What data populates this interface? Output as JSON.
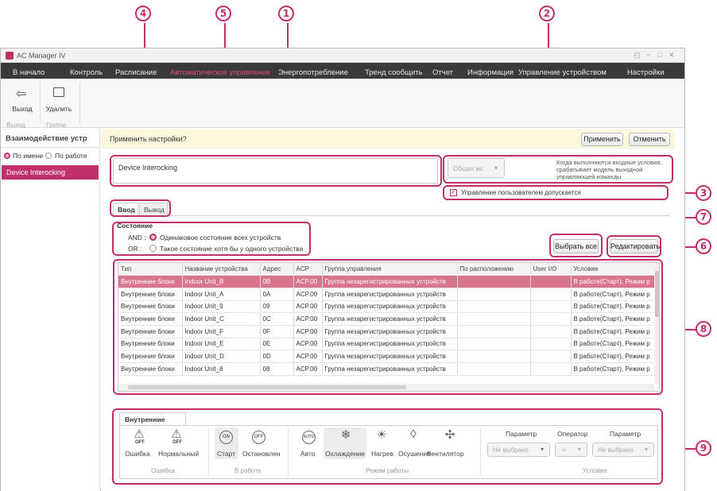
{
  "window": {
    "title": "AC Manager IV",
    "controls": [
      "◰",
      "−",
      "□",
      "✕"
    ]
  },
  "menu": [
    {
      "label": "В начало",
      "active": false
    },
    {
      "label": "Контроль",
      "active": false
    },
    {
      "label": "Расписание",
      "active": false
    },
    {
      "label": "Автоматическое управление",
      "active": true
    },
    {
      "label": "Энергопотребление",
      "active": false
    },
    {
      "label": "Тренд сообщить",
      "active": false
    },
    {
      "label": "Отчет",
      "active": false
    },
    {
      "label": "Информация",
      "active": false
    },
    {
      "label": "Управление устройством",
      "active": false
    },
    {
      "label": "Настройки",
      "active": false
    }
  ],
  "ribbon": {
    "exit_label": "Выход",
    "delete_label": "Удалить",
    "group_exit": "Выход",
    "group_group": "Группа"
  },
  "sidebar": {
    "title": "Взаимодействие устр",
    "radio_name": "По имени",
    "radio_work": "По работе",
    "item": "Device Interocking"
  },
  "topbar": {
    "question": "Применить настройки?",
    "apply": "Применить",
    "cancel": "Отменить"
  },
  "name_input": "Device Interocking",
  "common_dropdown": "Общая мс",
  "description": "Когда выполняются входные условия, срабатывает модель выходной управляющей команды",
  "user_control": "Управление пользователем допускается",
  "tabs": {
    "input": "Ввод",
    "output": "Вывод"
  },
  "condition": {
    "title": "Состояние",
    "and_label": "AND :",
    "and_text": "Одинаковое состояние всех устройств",
    "or_label": "OR :",
    "or_text": "Такое состояние хотя бы у одного устройства"
  },
  "buttons": {
    "select_all": "Выбрать все",
    "edit": "Редактировать"
  },
  "table": {
    "headers": [
      "Тип",
      "Название устройства",
      "Адрес",
      "ACP",
      "Группа управления",
      "По расположению",
      "User I/O",
      "Условие"
    ],
    "rows": [
      [
        "Внутренние блоки",
        "Indoor Unit_B",
        "0B",
        "ACP.00",
        "Группа незарегистрированных устройств",
        "",
        "",
        "В работе(Старт), Режим р"
      ],
      [
        "Внутренние блоки",
        "Indoor Unit_A",
        "0A",
        "ACP.00",
        "Группа незарегистрированных устройств",
        "",
        "",
        "В работе(Старт), Режим р"
      ],
      [
        "Внутренние блоки",
        "Indoor Unit_9",
        "09",
        "ACP.00",
        "Группа незарегистрированных устройств",
        "",
        "",
        "В работе(Старт), Режим р"
      ],
      [
        "Внутренние блоки",
        "Indoor Unit_C",
        "0C",
        "ACP.00",
        "Группа незарегистрированных устройств",
        "",
        "",
        "В работе(Старт), Режим р"
      ],
      [
        "Внутренние блоки",
        "Indoor Unit_F",
        "0F",
        "ACP.00",
        "Группа незарегистрированных устройств",
        "",
        "",
        "В работе(Старт), Режим р"
      ],
      [
        "Внутренние блоки",
        "Indoor Unit_E",
        "0E",
        "ACP.00",
        "Группа незарегистрированных устройств",
        "",
        "",
        "В работе(Старт), Режим р"
      ],
      [
        "Внутренние блоки",
        "Indoor Unit_D",
        "0D",
        "ACP.00",
        "Группа незарегистрированных устройств",
        "",
        "",
        "В работе(Старт), Режим р"
      ],
      [
        "Внутренние блоки",
        "Indoor Unit_8",
        "08",
        "ACP.00",
        "Группа незарегистрированных устройств",
        "",
        "",
        "В работе(Старт), Режим р"
      ]
    ]
  },
  "panel": {
    "tab": "Внутренние блоки",
    "error": "Ошибка",
    "normal": "Нормальный",
    "start": "Старт",
    "stopped": "Остановлен",
    "auto": "Авто",
    "cool": "Охлаждение",
    "heat": "Нагрев",
    "dry": "Осушение",
    "fan": "Вентилятор",
    "param1": "Параметр",
    "operator": "Оператор",
    "param2": "Параметр",
    "not_selected1": "Не выбрано",
    "eq": "=",
    "not_selected2": "Не выбрано",
    "sec_error": "Ошибка",
    "sec_work": "В работе",
    "sec_mode": "Режим работы",
    "sec_cond": "Условие",
    "off_small": "OFF",
    "on_badge": "ON",
    "off_badge": "OFF",
    "auto_badge": "AUTO"
  },
  "callouts": [
    "1",
    "2",
    "3",
    "4",
    "5",
    "6",
    "7",
    "8",
    "9"
  ],
  "colors": {
    "accent": "#c0306a",
    "menu_active": "#e0507a",
    "menubar": "#3a3a3a",
    "selected_row": "#d9748f"
  }
}
